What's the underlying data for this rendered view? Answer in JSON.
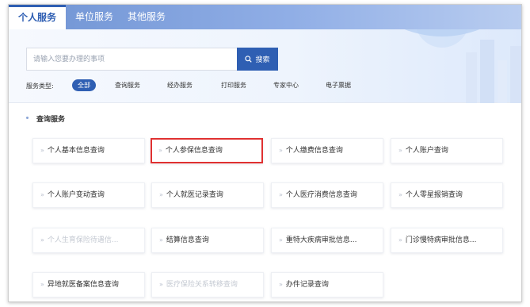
{
  "tabs": [
    {
      "label": "个人服务",
      "active": true
    },
    {
      "label": "单位服务",
      "active": false
    },
    {
      "label": "其他服务",
      "active": false
    }
  ],
  "search": {
    "placeholder": "请输入您要办理的事项",
    "button_label": "搜索",
    "button_icon": "search-icon"
  },
  "filter": {
    "label": "服务类型:",
    "chips": [
      {
        "label": "全部",
        "active": true
      },
      {
        "label": "查询服务",
        "active": false
      },
      {
        "label": "经办服务",
        "active": false
      },
      {
        "label": "打印服务",
        "active": false
      },
      {
        "label": "专家中心",
        "active": false
      },
      {
        "label": "电子票据",
        "active": false
      }
    ]
  },
  "section": {
    "title": "查询服务"
  },
  "cards": [
    {
      "label": "个人基本信息查询"
    },
    {
      "label": "个人参保信息查询",
      "highlighted": true
    },
    {
      "label": "个人缴费信息查询"
    },
    {
      "label": "个人账户查询"
    },
    {
      "label": "个人账户变动查询"
    },
    {
      "label": "个人就医记录查询"
    },
    {
      "label": "个人医疗消费信息查询"
    },
    {
      "label": "个人零星报销查询"
    },
    {
      "label": "个人生育保险待遇信...",
      "disabled": true
    },
    {
      "label": "结算信息查询"
    },
    {
      "label": "重特大疾病审批信息..."
    },
    {
      "label": "门诊慢特病审批信息..."
    },
    {
      "label": "异地就医备案信息查询"
    },
    {
      "label": "医疗保险关系转移查询",
      "disabled": true
    },
    {
      "label": "办件记录查询"
    }
  ],
  "colors": {
    "accent": "#2f5fb3",
    "highlight_border": "#e03131",
    "disabled_text": "#c4c9d2"
  }
}
